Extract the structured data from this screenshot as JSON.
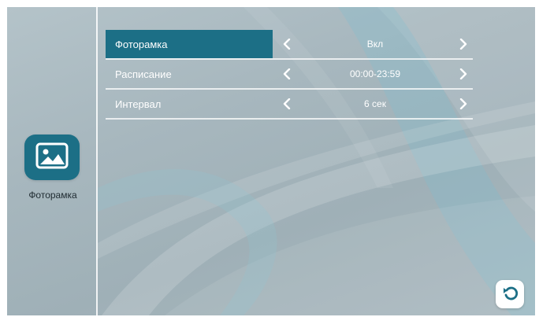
{
  "sidebar": {
    "app_label": "Фоторамка",
    "app_icon": "picture-icon",
    "accent_color": "#1c6f86"
  },
  "settings": {
    "rows": [
      {
        "label": "Фоторамка",
        "value": "Вкл",
        "selected": true
      },
      {
        "label": "Расписание",
        "value": "00:00-23:59",
        "selected": false
      },
      {
        "label": "Интервал",
        "value": "6 сек",
        "selected": false
      }
    ]
  },
  "controls": {
    "left_arrow_icon": "chevron-left-icon",
    "right_arrow_icon": "chevron-right-icon",
    "back_icon": "undo-arrow-icon"
  }
}
